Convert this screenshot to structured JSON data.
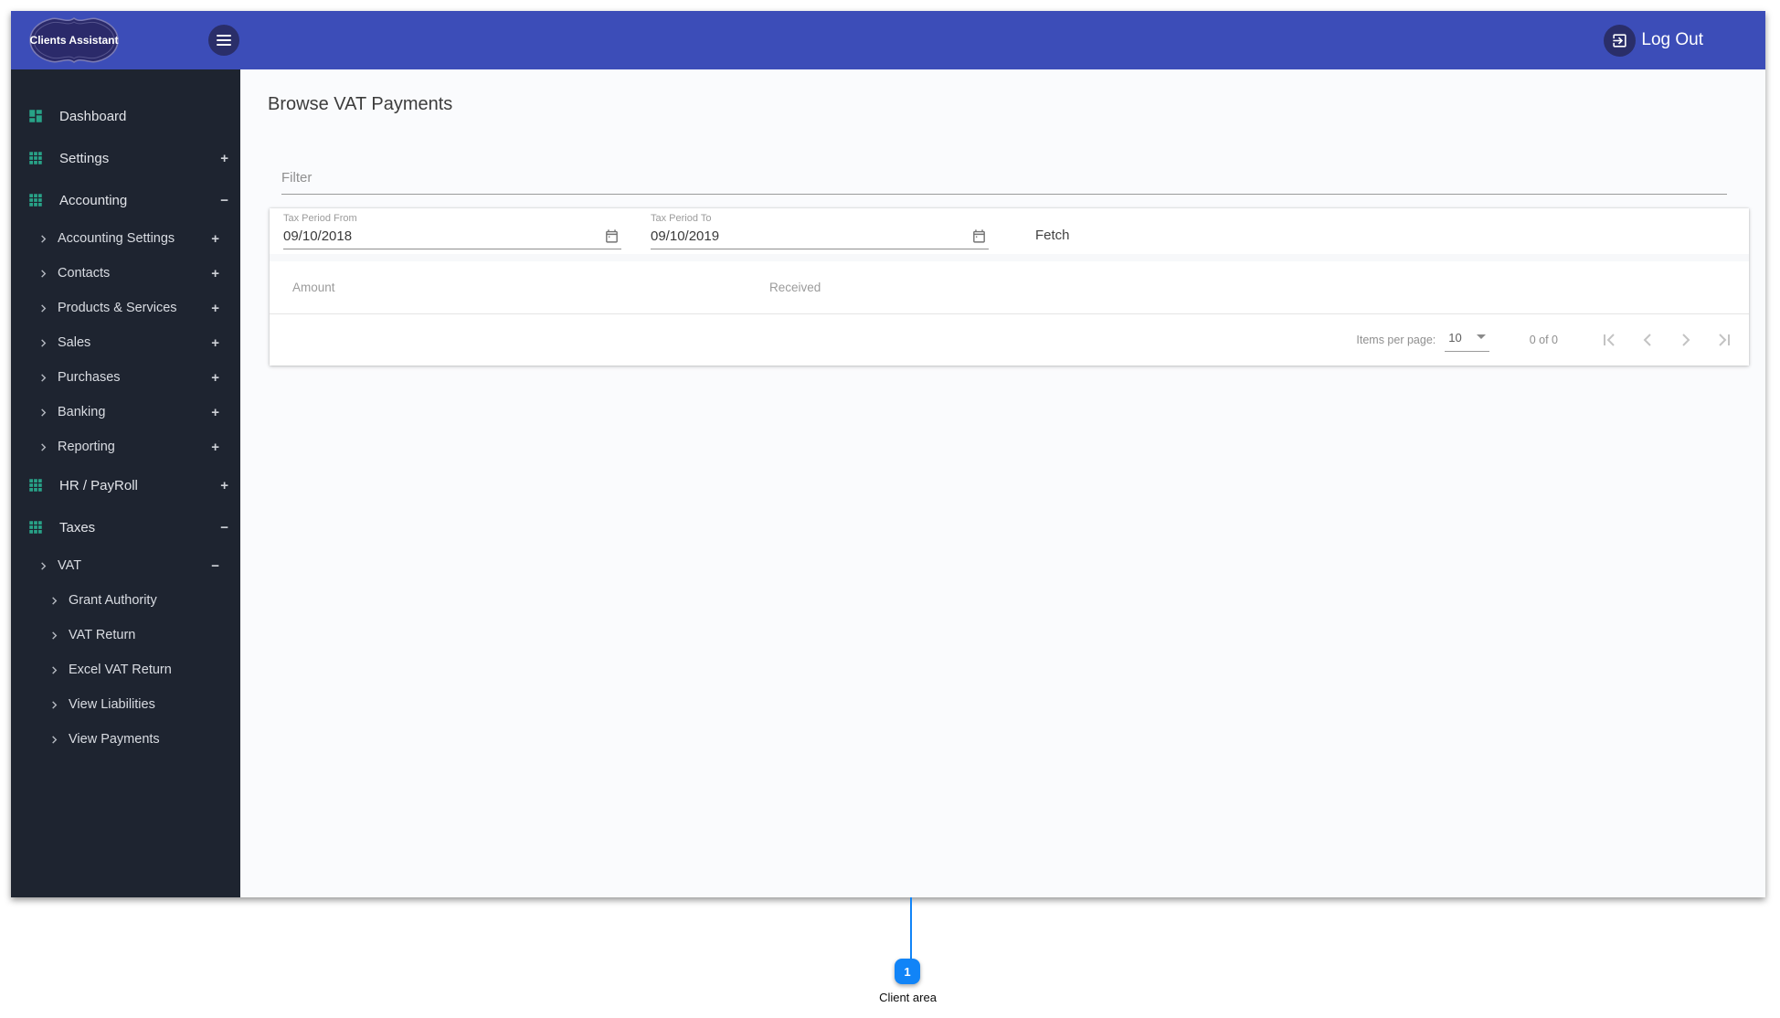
{
  "colors": {
    "header_blue": "#3c4db8",
    "logo_navy": "#2b2a6a",
    "circle_navy": "#2a2e69",
    "sidebar_bg": "#1e2430",
    "icon_teal": "#28a287",
    "content_bg": "#fafbfd",
    "callout_blue": "#1184f7"
  },
  "header": {
    "logo_text": "Clients Assistant",
    "menu_icon": "menu-icon",
    "logout_icon": "logout-exit-icon",
    "logout_label": "Log Out"
  },
  "sidebar": {
    "items": [
      {
        "label": "Dashboard",
        "level": 0,
        "icon": "dashboard-icon",
        "expander": null
      },
      {
        "label": "Settings",
        "level": 0,
        "icon": "apps-icon",
        "expander": "plus"
      },
      {
        "label": "Accounting",
        "level": 0,
        "icon": "apps-icon",
        "expander": "minus"
      },
      {
        "label": "Accounting Settings",
        "level": 1,
        "icon": "chevron-right-icon",
        "expander": "plus"
      },
      {
        "label": "Contacts",
        "level": 1,
        "icon": "chevron-right-icon",
        "expander": "plus"
      },
      {
        "label": "Products & Services",
        "level": 1,
        "icon": "chevron-right-icon",
        "expander": "plus"
      },
      {
        "label": "Sales",
        "level": 1,
        "icon": "chevron-right-icon",
        "expander": "plus"
      },
      {
        "label": "Purchases",
        "level": 1,
        "icon": "chevron-right-icon",
        "expander": "plus"
      },
      {
        "label": "Banking",
        "level": 1,
        "icon": "chevron-right-icon",
        "expander": "plus"
      },
      {
        "label": "Reporting",
        "level": 1,
        "icon": "chevron-right-icon",
        "expander": "plus"
      },
      {
        "label": "HR / PayRoll",
        "level": 0,
        "icon": "apps-icon",
        "expander": "plus"
      },
      {
        "label": "Taxes",
        "level": 0,
        "icon": "apps-icon",
        "expander": "minus"
      },
      {
        "label": "VAT",
        "level": 1,
        "icon": "chevron-right-icon",
        "expander": "minus"
      },
      {
        "label": "Grant Authority",
        "level": 2,
        "icon": "chevron-right-icon",
        "expander": null
      },
      {
        "label": "VAT Return",
        "level": 2,
        "icon": "chevron-right-icon",
        "expander": null
      },
      {
        "label": "Excel VAT Return",
        "level": 2,
        "icon": "chevron-right-icon",
        "expander": null
      },
      {
        "label": "View Liabilities",
        "level": 2,
        "icon": "chevron-right-icon",
        "expander": null
      },
      {
        "label": "View Payments",
        "level": 2,
        "icon": "chevron-right-icon",
        "expander": null
      }
    ],
    "expander_glyphs": {
      "plus": "+",
      "minus": "−"
    }
  },
  "main": {
    "title": "Browse VAT Payments",
    "filter": {
      "placeholder": "Filter"
    },
    "form": {
      "from_label": "Tax Period From",
      "from_value": "09/10/2018",
      "to_label": "Tax Period To",
      "to_value": "09/10/2019",
      "calendar_icon": "calendar-icon",
      "fetch_label": "Fetch"
    },
    "table": {
      "columns": [
        "Amount",
        "Received"
      ],
      "rows": []
    },
    "paginator": {
      "items_per_page_label": "Items per page:",
      "page_size": "10",
      "range_label": "0 of 0",
      "nav_icons": [
        "first-page-icon",
        "previous-page-icon",
        "next-page-icon",
        "last-page-icon"
      ]
    }
  },
  "annotation": {
    "badge_number": "1",
    "label": "Client area"
  }
}
